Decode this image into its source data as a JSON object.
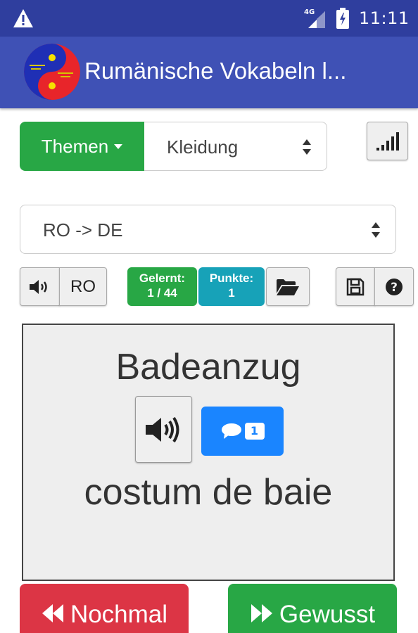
{
  "status_bar": {
    "network_label": "4G",
    "time": "11:11"
  },
  "app_bar": {
    "title": "Rumänische Vokabeln l..."
  },
  "topic_selector": {
    "button_label": "Themen",
    "selected_topic": "Kleidung"
  },
  "direction_selector": {
    "selected": "RO -> DE"
  },
  "toolbar": {
    "language_label": "RO",
    "learned_label": "Gelernt:",
    "learned_value": "1 / 44",
    "points_label": "Punkte:",
    "points_value": "1"
  },
  "card": {
    "word_de": "Badeanzug",
    "word_ro": "costum de baie",
    "comment_count": "1"
  },
  "actions": {
    "again_label": "Nochmal",
    "known_label": "Gewusst"
  },
  "colors": {
    "status_bar": "#2f3e9e",
    "app_bar": "#3f51b5",
    "success": "#28a745",
    "info": "#17a2b8",
    "danger": "#dc3545",
    "primary": "#1a85ff"
  },
  "icons": [
    "warning-icon",
    "signal-icon",
    "battery-icon",
    "speaker-icon",
    "folder-open-icon",
    "save-icon",
    "help-icon",
    "comment-icon",
    "backward-icon",
    "forward-icon",
    "sort-icon",
    "signal-bars-icon"
  ]
}
